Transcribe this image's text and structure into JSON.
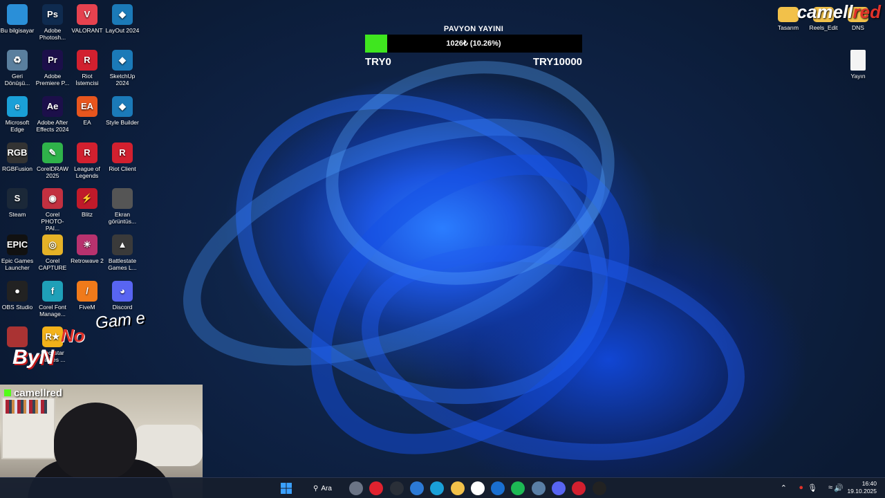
{
  "desktop_icons": [
    {
      "label": "Bu bilgisayar",
      "icon": "computer-icon",
      "glyph": "",
      "color": "#2a8fd8"
    },
    {
      "label": "Adobe Photosh...",
      "icon": "photoshop-icon",
      "glyph": "Ps",
      "color": "#0f2b4f"
    },
    {
      "label": "VALORANT",
      "icon": "valorant-icon",
      "glyph": "V",
      "color": "#e6424f"
    },
    {
      "label": "LayOut 2024",
      "icon": "layout-icon",
      "glyph": "◆",
      "color": "#1b7ab8"
    },
    {
      "label": "Geri Dönüşü...",
      "icon": "recycle-bin-icon",
      "glyph": "♻",
      "color": "#5a7f9e"
    },
    {
      "label": "Adobe Premiere P...",
      "icon": "premiere-icon",
      "glyph": "Pr",
      "color": "#1c0f4a"
    },
    {
      "label": "Riot İstemcisi",
      "icon": "riot-client-icon",
      "glyph": "R",
      "color": "#d2202f"
    },
    {
      "label": "SketchUp 2024",
      "icon": "sketchup-icon",
      "glyph": "◆",
      "color": "#1b7ab8"
    },
    {
      "label": "Microsoft Edge",
      "icon": "edge-icon",
      "glyph": "e",
      "color": "#1aa0d8"
    },
    {
      "label": "Adobe After Effects 2024",
      "icon": "after-effects-icon",
      "glyph": "Ae",
      "color": "#1c0f4a"
    },
    {
      "label": "EA",
      "icon": "ea-icon",
      "glyph": "EA",
      "color": "#e8561e"
    },
    {
      "label": "Style Builder",
      "icon": "style-builder-icon",
      "glyph": "◆",
      "color": "#1b7ab8"
    },
    {
      "label": "RGBFusion",
      "icon": "rgbfusion-icon",
      "glyph": "RGB",
      "color": "#333333"
    },
    {
      "label": "CorelDRAW 2025",
      "icon": "coreldraw-icon",
      "glyph": "✎",
      "color": "#2fb34a"
    },
    {
      "label": "League of Legends",
      "icon": "league-icon",
      "glyph": "R",
      "color": "#d2202f"
    },
    {
      "label": "Riot Client",
      "icon": "riot-client-icon",
      "glyph": "R",
      "color": "#d2202f"
    },
    {
      "label": "Steam",
      "icon": "steam-icon",
      "glyph": "S",
      "color": "#1b2838"
    },
    {
      "label": "Corel PHOTO-PAI...",
      "icon": "corel-photopaint-icon",
      "glyph": "◉",
      "color": "#c23040"
    },
    {
      "label": "Blitz",
      "icon": "blitz-icon",
      "glyph": "⚡",
      "color": "#c01a2a"
    },
    {
      "label": "Ekran görüntüs...",
      "icon": "screenshot-file-icon",
      "glyph": "",
      "color": "#555555"
    },
    {
      "label": "Epic Games Launcher",
      "icon": "epic-games-icon",
      "glyph": "EPIC",
      "color": "#111111"
    },
    {
      "label": "Corel CAPTURE",
      "icon": "corel-capture-icon",
      "glyph": "◎",
      "color": "#e5b227"
    },
    {
      "label": "Retrowave 2",
      "icon": "retrowave-icon",
      "glyph": "☀",
      "color": "#b8326e"
    },
    {
      "label": "Battlestate Games L...",
      "icon": "battlestate-icon",
      "glyph": "▲",
      "color": "#3a3a3a"
    },
    {
      "label": "OBS Studio",
      "icon": "obs-icon",
      "glyph": "●",
      "color": "#222222"
    },
    {
      "label": "Corel Font Manage...",
      "icon": "corel-font-icon",
      "glyph": "f",
      "color": "#1fa0b8"
    },
    {
      "label": "FiveM",
      "icon": "fivem-icon",
      "glyph": "/",
      "color": "#f07a1a"
    },
    {
      "label": "Discord",
      "icon": "discord-icon",
      "glyph": "◕",
      "color": "#5865f2"
    },
    {
      "label": "",
      "icon": "unknown-app-icon",
      "glyph": "",
      "color": "#a33"
    },
    {
      "label": "Rockstar Games ...",
      "icon": "rockstar-icon",
      "glyph": "R★",
      "color": "#f3b21a"
    }
  ],
  "right_icons": [
    {
      "label": "Tasarım",
      "icon": "folder-icon"
    },
    {
      "label": "Reels_Edit",
      "icon": "folder-icon"
    },
    {
      "label": "DNS",
      "icon": "folder-icon"
    },
    {
      "label": "Yayın",
      "icon": "text-file-icon"
    }
  ],
  "progress": {
    "title": "PAVYON YAYINI",
    "text": "1026₺ (10.26%)",
    "fraction": 0.1026,
    "min_label": "TRY0",
    "max_label": "TRY10000",
    "fill_color": "#3fe61f"
  },
  "brand": {
    "part1": "camell",
    "part2": "red"
  },
  "overlay": {
    "game": "Gam e",
    "no": "No",
    "byn": "ByN"
  },
  "webcam": {
    "handle": "camellred"
  },
  "taskbar": {
    "search_label": "Ara",
    "apps": [
      {
        "icon": "task-view-icon",
        "color": "#6b7486"
      },
      {
        "icon": "opera-gx-icon",
        "color": "#e0222f"
      },
      {
        "icon": "circle-app-icon",
        "color": "#2a2f38"
      },
      {
        "icon": "store-app-icon",
        "color": "#2c7ad6"
      },
      {
        "icon": "edge-taskbar-icon",
        "color": "#1aa0d8"
      },
      {
        "icon": "file-explorer-icon",
        "color": "#f2c14a"
      },
      {
        "icon": "microsoft-store-icon",
        "color": "#ffffff"
      },
      {
        "icon": "mail-icon",
        "color": "#1a6fd0"
      },
      {
        "icon": "spotify-icon",
        "color": "#1db954"
      },
      {
        "icon": "sketchup-taskbar-icon",
        "color": "#5a7fa6"
      },
      {
        "icon": "discord-taskbar-icon",
        "color": "#5865f2"
      },
      {
        "icon": "riot-taskbar-icon",
        "color": "#d2202f"
      },
      {
        "icon": "obs-taskbar-icon",
        "color": "#222"
      }
    ]
  },
  "tray": {
    "time": "16:40",
    "date": "19.10.2025"
  }
}
